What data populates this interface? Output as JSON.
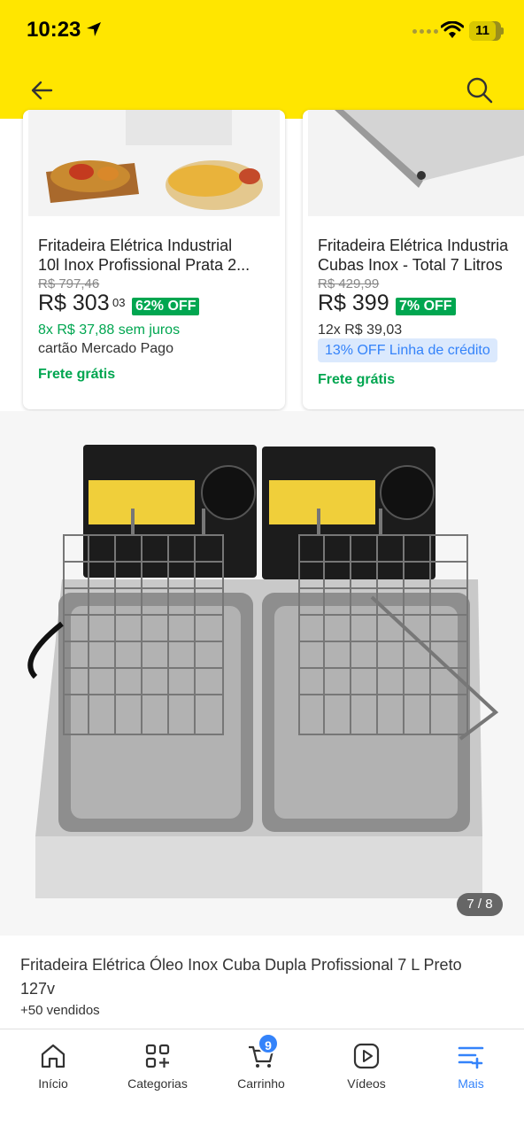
{
  "status_bar": {
    "time": "10:23",
    "battery": "11"
  },
  "cards": [
    {
      "title_line1": "Fritadeira Elétrica Industrial",
      "title_line2": "10l Inox Profissional Prata 2...",
      "old_price": "R$ 797,46",
      "price": "R$ 303",
      "cents": "03",
      "discount": "62% OFF",
      "installments": "8x R$ 37,88 sem juros",
      "payment_note": "cartão Mercado Pago",
      "shipping": "Frete grátis"
    },
    {
      "title_line1": "Fritadeira Elétrica Industria",
      "title_line2": "Cubas Inox - Total 7 Litros",
      "old_price": "R$ 429,99",
      "price": "R$ 399",
      "discount": "7% OFF",
      "installments": "12x R$ 39,03",
      "credit_tag": "13% OFF Linha de crédito",
      "shipping": "Frete grátis"
    }
  ],
  "product": {
    "image_counter": "7 / 8",
    "title": "Fritadeira Elétrica Óleo Inox Cuba Dupla Profissional 7 L Preto 127v",
    "sold": "+50 vendidos"
  },
  "nav": {
    "items": [
      {
        "label": "Início",
        "icon": "home-icon"
      },
      {
        "label": "Categorias",
        "icon": "categories-icon"
      },
      {
        "label": "Carrinho",
        "icon": "cart-icon"
      },
      {
        "label": "Vídeos",
        "icon": "video-icon"
      },
      {
        "label": "Mais",
        "icon": "more-icon"
      }
    ],
    "cart_count": "9"
  },
  "colors": {
    "brand_yellow": "#FFE600",
    "accent_blue": "#3483fa",
    "discount_green": "#00a650"
  }
}
